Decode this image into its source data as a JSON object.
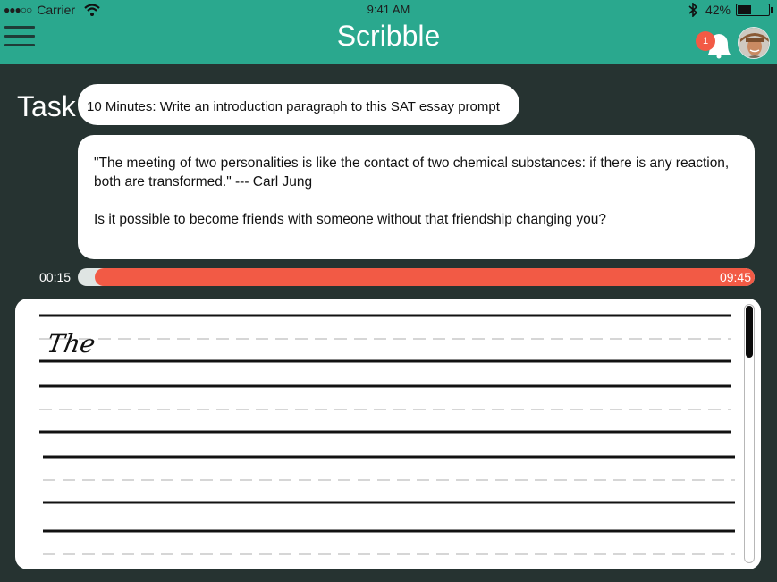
{
  "status_bar": {
    "carrier": "Carrier",
    "signal_dots": "●●●○○",
    "time": "9:41 AM",
    "battery": "42%",
    "battery_level": 0.42
  },
  "header": {
    "title": "Scribble",
    "notification_count": "1",
    "accent_color": "#2aa88e"
  },
  "task": {
    "label": "Task",
    "summary": "10 Minutes: Write an introduction paragraph to this SAT essay prompt",
    "quote_line1": "\"The meeting of two personalities is like the contact of two chemical substances: if there is any reaction,",
    "quote_line2": "both are transformed.\" --- Carl Jung",
    "question": "Is it possible to become friends with someone without that friendship changing you?"
  },
  "timer": {
    "elapsed": "00:15",
    "remaining": "09:45",
    "progress_fraction": 0.025,
    "bar_color": "#f25a45"
  },
  "writing": {
    "text": "The"
  },
  "icons": [
    "signal-dots-icon",
    "wifi-icon",
    "bluetooth-icon",
    "battery-icon",
    "menu-icon",
    "bell-icon",
    "avatar-image"
  ]
}
